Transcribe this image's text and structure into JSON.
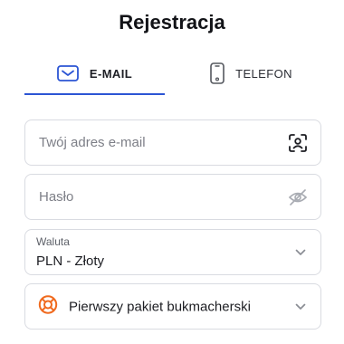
{
  "page": {
    "title": "Rejestracja"
  },
  "tabs": [
    {
      "label": "E-MAIL",
      "icon": "envelope-icon",
      "active": true
    },
    {
      "label": "TELEFON",
      "icon": "smartphone-icon",
      "active": false
    }
  ],
  "form": {
    "email": {
      "placeholder": "Twój adres e-mail",
      "icon": "contact-scan-icon"
    },
    "password": {
      "placeholder": "Hasło",
      "icon": "eye-off-icon"
    },
    "currency": {
      "label": "Waluta",
      "value": "PLN - Złoty",
      "icon": "chevron-down-icon"
    },
    "bonus": {
      "value": "Pierwszy pakiet bukmacherski",
      "icon": "lifebuoy-icon"
    }
  },
  "colors": {
    "accent": "#2c55d4",
    "bonus_icon": "#f06a1e",
    "border": "#d9dbe1"
  }
}
